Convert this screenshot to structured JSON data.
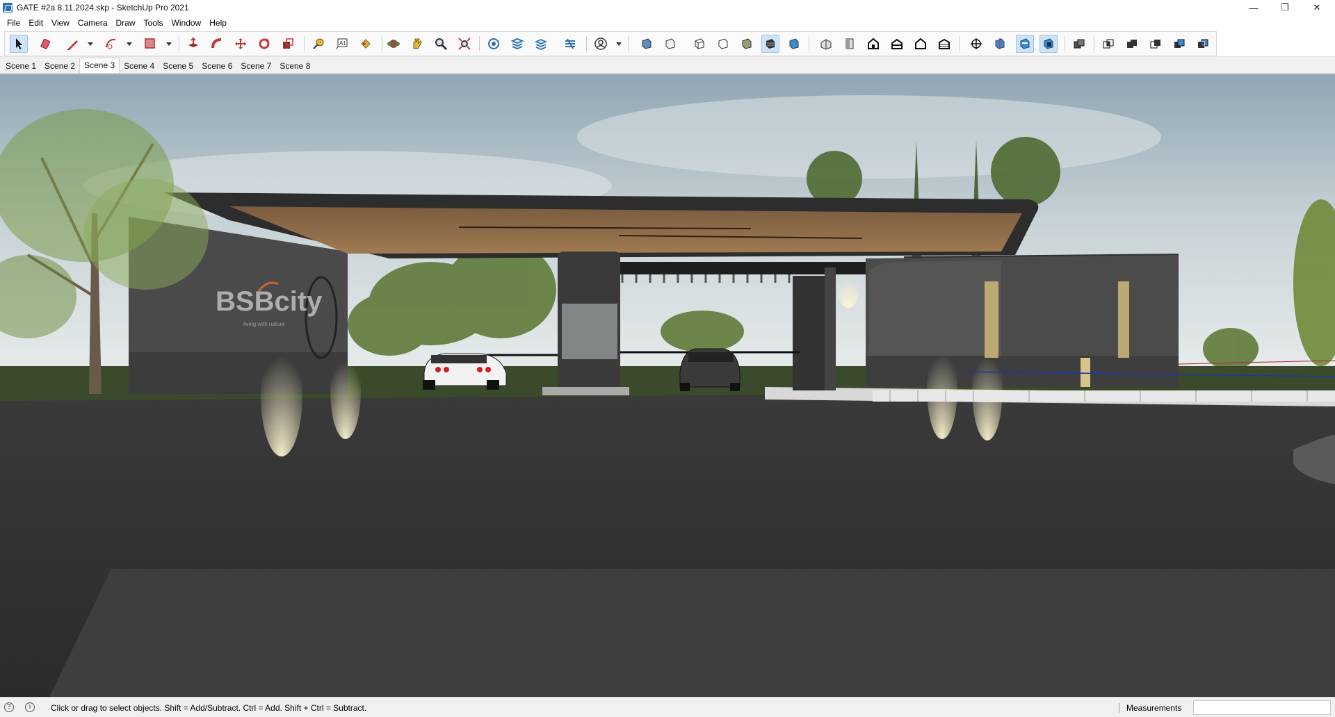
{
  "window": {
    "title": "GATE #2a 8.11.2024.skp - SketchUp Pro 2021",
    "minimize": "—",
    "restore": "❐",
    "close": "✕"
  },
  "menu": [
    "File",
    "Edit",
    "View",
    "Camera",
    "Draw",
    "Tools",
    "Window",
    "Help"
  ],
  "toolbar": {
    "tools": [
      {
        "icon": "select-arrow-icon",
        "active": true
      },
      {
        "icon": "eraser-icon"
      },
      {
        "icon": "pencil-line-icon"
      },
      {
        "icon": "arc-icon"
      },
      {
        "icon": "rectangle-shape-icon"
      },
      {
        "icon": "push-pull-icon"
      },
      {
        "icon": "follow-me-icon"
      },
      {
        "icon": "move-icon"
      },
      {
        "icon": "rotate-icon"
      },
      {
        "icon": "scale-icon"
      },
      {
        "icon": "tape-measure-icon"
      },
      {
        "icon": "text-icon"
      },
      {
        "icon": "paint-bucket-icon"
      },
      {
        "icon": "orbit-icon"
      },
      {
        "icon": "pan-hand-icon"
      },
      {
        "icon": "zoom-icon"
      },
      {
        "icon": "zoom-extents-icon"
      },
      {
        "icon": "warehouse-icon"
      },
      {
        "icon": "extension-warehouse-icon"
      },
      {
        "icon": "layout-send-icon"
      },
      {
        "icon": "extension-manager-icon"
      },
      {
        "icon": "account-icon"
      },
      {
        "icon": "xray-icon"
      },
      {
        "icon": "back-edges-icon"
      },
      {
        "icon": "wireframe-icon"
      },
      {
        "icon": "hidden-line-icon"
      },
      {
        "icon": "shaded-icon"
      },
      {
        "icon": "shaded-textures-icon",
        "active": true
      },
      {
        "icon": "monochrome-icon"
      },
      {
        "icon": "iso-view-icon"
      },
      {
        "icon": "top-view-icon"
      },
      {
        "icon": "front-view-icon"
      },
      {
        "icon": "right-view-icon"
      },
      {
        "icon": "back-view-icon"
      },
      {
        "icon": "left-view-icon"
      },
      {
        "icon": "section-plane-icon"
      },
      {
        "icon": "display-section-planes-icon"
      },
      {
        "icon": "display-section-cuts-icon",
        "active": true
      },
      {
        "icon": "display-section-fill-icon",
        "active": true
      },
      {
        "icon": "solid-tools-outer-shell-icon"
      },
      {
        "icon": "intersect-icon"
      },
      {
        "icon": "union-icon"
      },
      {
        "icon": "subtract-icon"
      },
      {
        "icon": "trim-icon"
      },
      {
        "icon": "split-icon"
      }
    ]
  },
  "scenes": {
    "tabs": [
      "Scene 1",
      "Scene 2",
      "Scene 3",
      "Scene 4",
      "Scene 5",
      "Scene 6",
      "Scene 7",
      "Scene 8"
    ],
    "active": "Scene 3"
  },
  "viewport": {
    "sign_text": "BSBcity",
    "sign_subtext": "living with nature"
  },
  "status": {
    "hint": "Click or drag to select objects. Shift = Add/Subtract. Ctrl = Add. Shift + Ctrl = Subtract.",
    "measurements_label": "Measurements",
    "measurements_value": ""
  }
}
